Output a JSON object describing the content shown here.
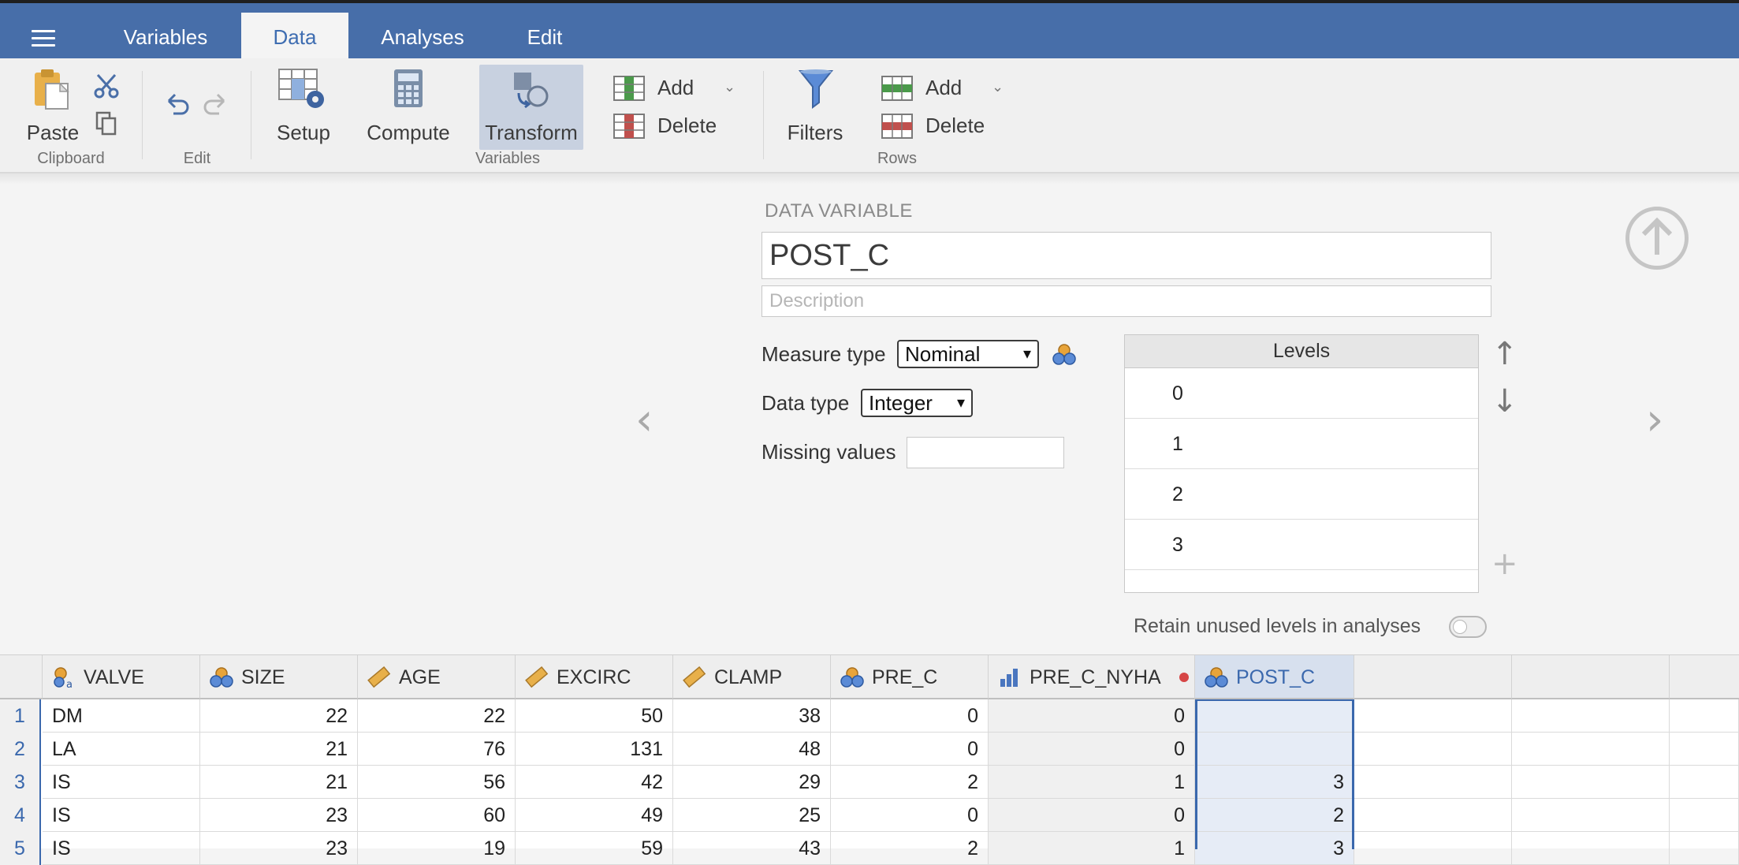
{
  "tabs": [
    {
      "label": "Variables",
      "active": false
    },
    {
      "label": "Data",
      "active": true
    },
    {
      "label": "Analyses",
      "active": false
    },
    {
      "label": "Edit",
      "active": false
    }
  ],
  "ribbon": {
    "paste": "Paste",
    "setup": "Setup",
    "compute": "Compute",
    "transform": "Transform",
    "var_add": "Add",
    "var_delete": "Delete",
    "filters": "Filters",
    "row_add": "Add",
    "row_delete": "Delete",
    "groups": {
      "clipboard": "Clipboard",
      "edit": "Edit",
      "variables": "Variables",
      "rows": "Rows"
    }
  },
  "editor": {
    "section_label": "DATA VARIABLE",
    "name": "POST_C",
    "description_placeholder": "Description",
    "measure_type_label": "Measure type",
    "measure_type_value": "Nominal",
    "data_type_label": "Data type",
    "data_type_value": "Integer",
    "missing_values_label": "Missing values",
    "levels_header": "Levels",
    "levels": [
      "0",
      "1",
      "2",
      "3"
    ],
    "retain_label": "Retain unused levels in analyses"
  },
  "grid": {
    "columns": [
      {
        "name": "VALVE",
        "icon": "nominal-text-icon"
      },
      {
        "name": "SIZE",
        "icon": "nominal-icon"
      },
      {
        "name": "AGE",
        "icon": "continuous-ruler-icon"
      },
      {
        "name": "EXCIRC",
        "icon": "continuous-ruler-icon"
      },
      {
        "name": "CLAMP",
        "icon": "continuous-ruler-icon"
      },
      {
        "name": "PRE_C",
        "icon": "nominal-icon"
      },
      {
        "name": "PRE_C_NYHA",
        "icon": "ordinal-bars-icon"
      },
      {
        "name": "POST_C",
        "icon": "nominal-icon"
      }
    ],
    "row_numbers": [
      "1",
      "2",
      "3",
      "4",
      "5"
    ],
    "rows": [
      [
        "DM",
        "22",
        "22",
        "50",
        "38",
        "0",
        "0",
        ""
      ],
      [
        "LA",
        "21",
        "76",
        "131",
        "48",
        "0",
        "0",
        ""
      ],
      [
        "IS",
        "21",
        "56",
        "42",
        "29",
        "2",
        "1",
        "3"
      ],
      [
        "IS",
        "23",
        "60",
        "49",
        "25",
        "0",
        "0",
        "2"
      ],
      [
        "IS",
        "23",
        "19",
        "59",
        "43",
        "2",
        "1",
        "3"
      ]
    ]
  },
  "colors": {
    "accent": "#476ea9",
    "selection": "#3a68ad",
    "nominal_blue": "#5b8bd6",
    "nominal_orange": "#e8a43a",
    "ruler_yellow": "#e8b04a",
    "dot_red": "#d64545"
  }
}
